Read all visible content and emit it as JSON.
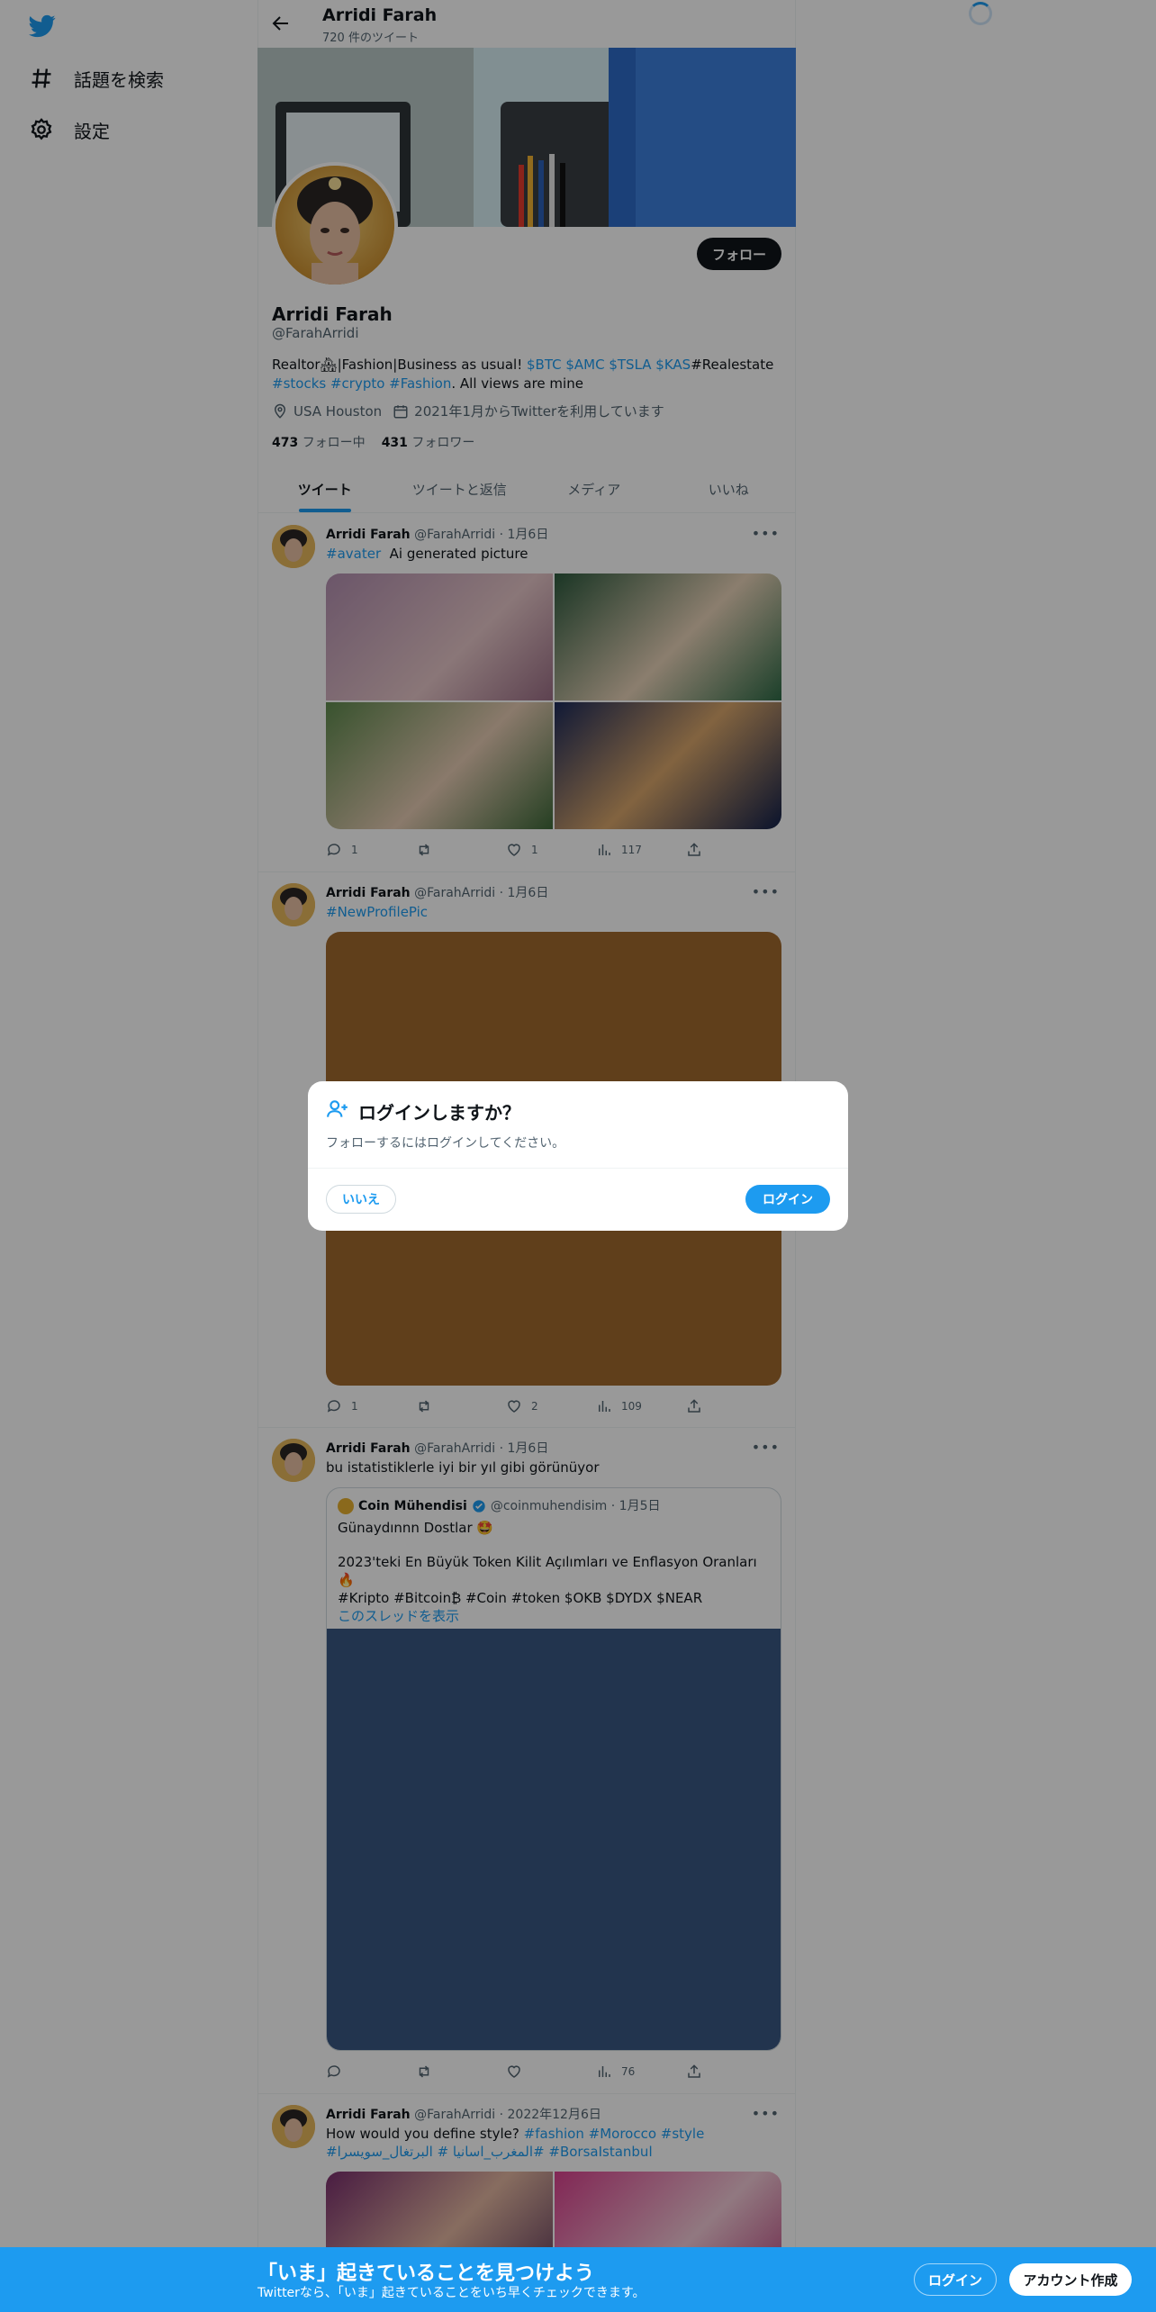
{
  "nav": {
    "explore_label": "話題を検索",
    "settings_label": "設定"
  },
  "header": {
    "name": "Arridi Farah",
    "tweet_count": "720 件のツイート"
  },
  "profile": {
    "follow_label": "フォロー",
    "name": "Arridi Farah",
    "handle": "@FarahArridi",
    "bio_prefix": "Realtor🏘|Fashion|Business as usual! ",
    "bio_tags1": "$BTC $AMC $TSLA $KAS",
    "bio_mid": "#Realestate",
    "bio_tags2": "#stocks #crypto #Fashion",
    "bio_suffix": ". All views are mine",
    "location": "USA Houston",
    "joined": "2021年1月からTwitterを利用しています",
    "following_count": "473",
    "following_label": "フォロー中",
    "followers_count": "431",
    "followers_label": "フォロワー"
  },
  "tabs": [
    {
      "label": "ツイート"
    },
    {
      "label": "ツイートと返信"
    },
    {
      "label": "メディア"
    },
    {
      "label": "いいね"
    }
  ],
  "tweets": [
    {
      "name": "Arridi Farah",
      "meta": "@FarahArridi · 1月6日",
      "hashtag": "#avater",
      "text": "Ai generated picture",
      "replies": "1",
      "likes": "1",
      "views": "117"
    },
    {
      "name": "Arridi Farah",
      "meta": "@FarahArridi · 1月6日",
      "hashtag": "#NewProfilePic",
      "replies": "1",
      "likes": "2",
      "views": "109",
      "media_color": "#a0692d"
    },
    {
      "name": "Arridi Farah",
      "meta": "@FarahArridi · 1月6日",
      "text": "bu istatistiklerle iyi bir yıl gibi görünüyor",
      "quote": {
        "name": "Coin Mühendisi",
        "meta": "@coinmuhendisim · 1月5日",
        "line1": "Günaydınnn Dostlar 🤩",
        "line2": "2023'teki En Büyük Token Kilit Açılımları ve Enflasyon Oranları 🔥",
        "line3": "#Kripto #Bitcoin₿  #Coin #token $OKB $DYDX $NEAR",
        "thread_link": "このスレッドを表示"
      },
      "views": "76",
      "media_color": "#3a5782"
    },
    {
      "name": "Arridi Farah",
      "meta": "@FarahArridi · 2022年12月6日",
      "text": "How would you define style?",
      "tags": "#fashion #Morocco #style",
      "tags2": "#المغرب_اسانيا # البرتغال_سويسرا# #BorsaIstanbul"
    }
  ],
  "modal": {
    "title": "ログインしますか？",
    "subtitle": "フォローするにはログインしてください。",
    "no_label": "いいえ",
    "yes_label": "ログイン"
  },
  "bottom_bar": {
    "title": "「いま」起きていることを見つけよう",
    "subtitle": "Twitterなら、「いま」起きていることをいち早くチェックできます。",
    "login_label": "ログイン",
    "signup_label": "アカウント作成"
  },
  "colors": {
    "accent": "#1d9bf0",
    "text": "#0f1419",
    "muted": "#536471"
  }
}
